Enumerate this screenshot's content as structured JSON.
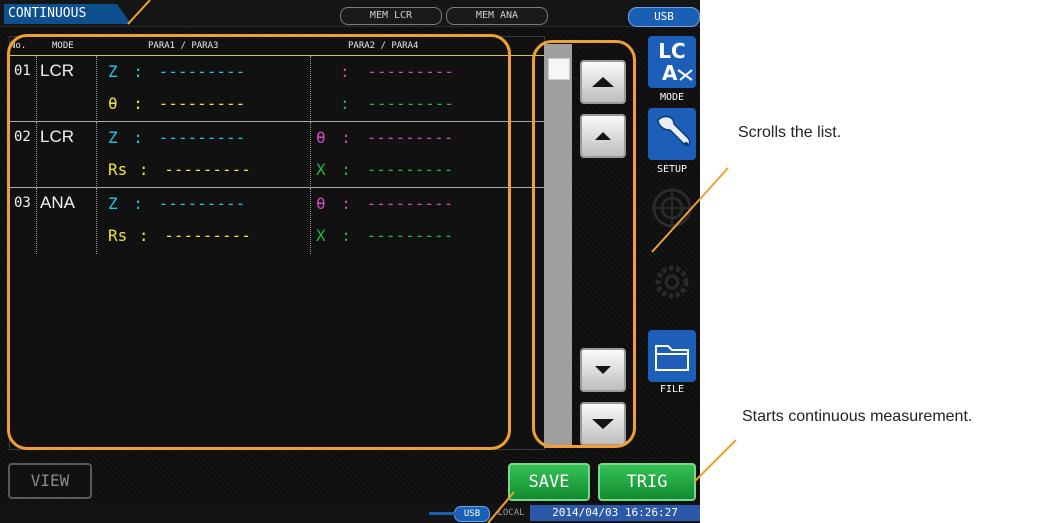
{
  "screen": {
    "title": "CONTINUOUS",
    "mem_tabs": [
      "MEM LCR",
      "MEM ANA"
    ],
    "usb_top": "USB"
  },
  "table": {
    "headers": {
      "no": "No.",
      "mode": "MODE",
      "para13": "PARA1 / PARA3",
      "para24": "PARA2 / PARA4"
    },
    "rows": [
      {
        "no": "01",
        "mode": "LCR",
        "p1": {
          "label": "Z",
          "sep": ":",
          "value": "---------"
        },
        "p3": {
          "label": "θ",
          "sep": ":",
          "value": "---------"
        },
        "p2": {
          "label": "",
          "sep": ":",
          "value": "---------"
        },
        "p4": {
          "label": "",
          "sep": ":",
          "value": "---------"
        }
      },
      {
        "no": "02",
        "mode": "LCR",
        "p1": {
          "label": "Z",
          "sep": ":",
          "value": "---------"
        },
        "p3": {
          "label": "Rs",
          "sep": ":",
          "value": "---------"
        },
        "p2": {
          "label": "θ",
          "sep": ":",
          "value": "---------"
        },
        "p4": {
          "label": "X",
          "sep": ":",
          "value": "---------"
        }
      },
      {
        "no": "03",
        "mode": "ANA",
        "p1": {
          "label": "Z",
          "sep": ":",
          "value": "---------"
        },
        "p3": {
          "label": "Rs",
          "sep": ":",
          "value": "---------"
        },
        "p2": {
          "label": "θ",
          "sep": ":",
          "value": "---------"
        },
        "p4": {
          "label": "X",
          "sep": ":",
          "value": "---------"
        }
      }
    ]
  },
  "side": {
    "mode_icon_text": "LC A",
    "mode_label": "MODE",
    "setup_label": "SETUP",
    "file_label": "FILE"
  },
  "buttons": {
    "view": "VIEW",
    "save": "SAVE",
    "trig": "TRIG"
  },
  "status": {
    "usb": "USB",
    "local": "LOCAL",
    "datetime": "2014/04/03 16:26:27"
  },
  "annotations": {
    "scroll": "Scrolls the list.",
    "trig": "Starts continuous measurement."
  },
  "colors": {
    "accent": "#f0a033",
    "title_blue": "#0e4f8e",
    "green": "#1fbd42",
    "cyan": "#1ec8e6",
    "yellow": "#f3e23d",
    "magenta": "#d04ac0"
  }
}
